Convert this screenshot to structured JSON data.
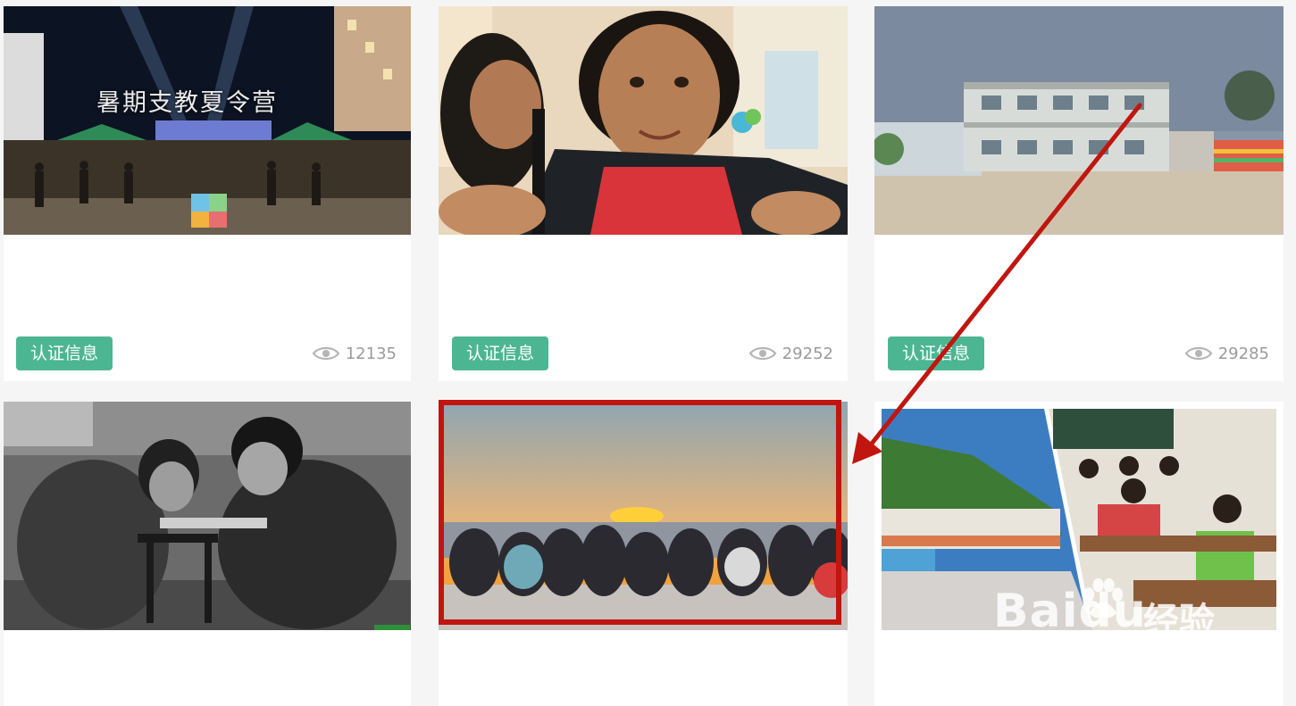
{
  "cards": [
    {
      "photo_caption": "暑期支教夏令营",
      "badge": "认证信息",
      "views": "12135",
      "photo_icon": "summer-camp-photo"
    },
    {
      "badge": "认证信息",
      "views": "29252",
      "photo_icon": "children-photo"
    },
    {
      "badge": "认证信息",
      "views": "29285",
      "photo_icon": "school-building-photo"
    },
    {
      "photo_icon": "grayscale-children-photo"
    },
    {
      "photo_icon": "sunset-group-photo"
    },
    {
      "photo_icon": "classroom-photo"
    }
  ],
  "watermark": {
    "brand": "Baidu",
    "brand_cn": "经验",
    "url": "jingyan.baidu.com"
  },
  "annotations": {
    "highlight_color": "#c0160f",
    "arrow_color": "#c0160f"
  },
  "colors": {
    "badge": "#4cb693",
    "page_bg": "#f5f5f5"
  }
}
